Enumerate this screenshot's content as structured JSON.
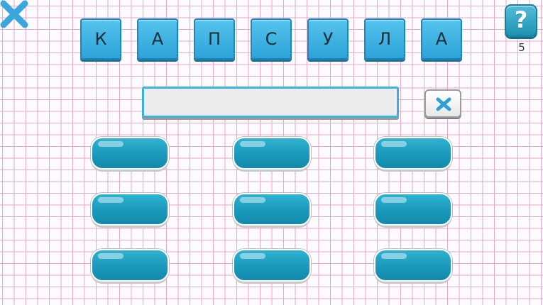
{
  "header": {
    "close_icon": "close-x-icon",
    "help": {
      "label": "?",
      "icon": "question-mark-icon",
      "hint_count": "5"
    }
  },
  "letters": [
    "К",
    "А",
    "П",
    "С",
    "У",
    "Л",
    "А"
  ],
  "answer": {
    "value": ""
  },
  "clear_button": {
    "icon": "clear-x-icon"
  },
  "word_slots": [
    "",
    "",
    "",
    "",
    "",
    "",
    "",
    "",
    ""
  ],
  "colors": {
    "accent": "#2ca3d8",
    "slot": "#1a98bb",
    "grid": "#e2aacb",
    "close_x": "#3aa6dd"
  }
}
